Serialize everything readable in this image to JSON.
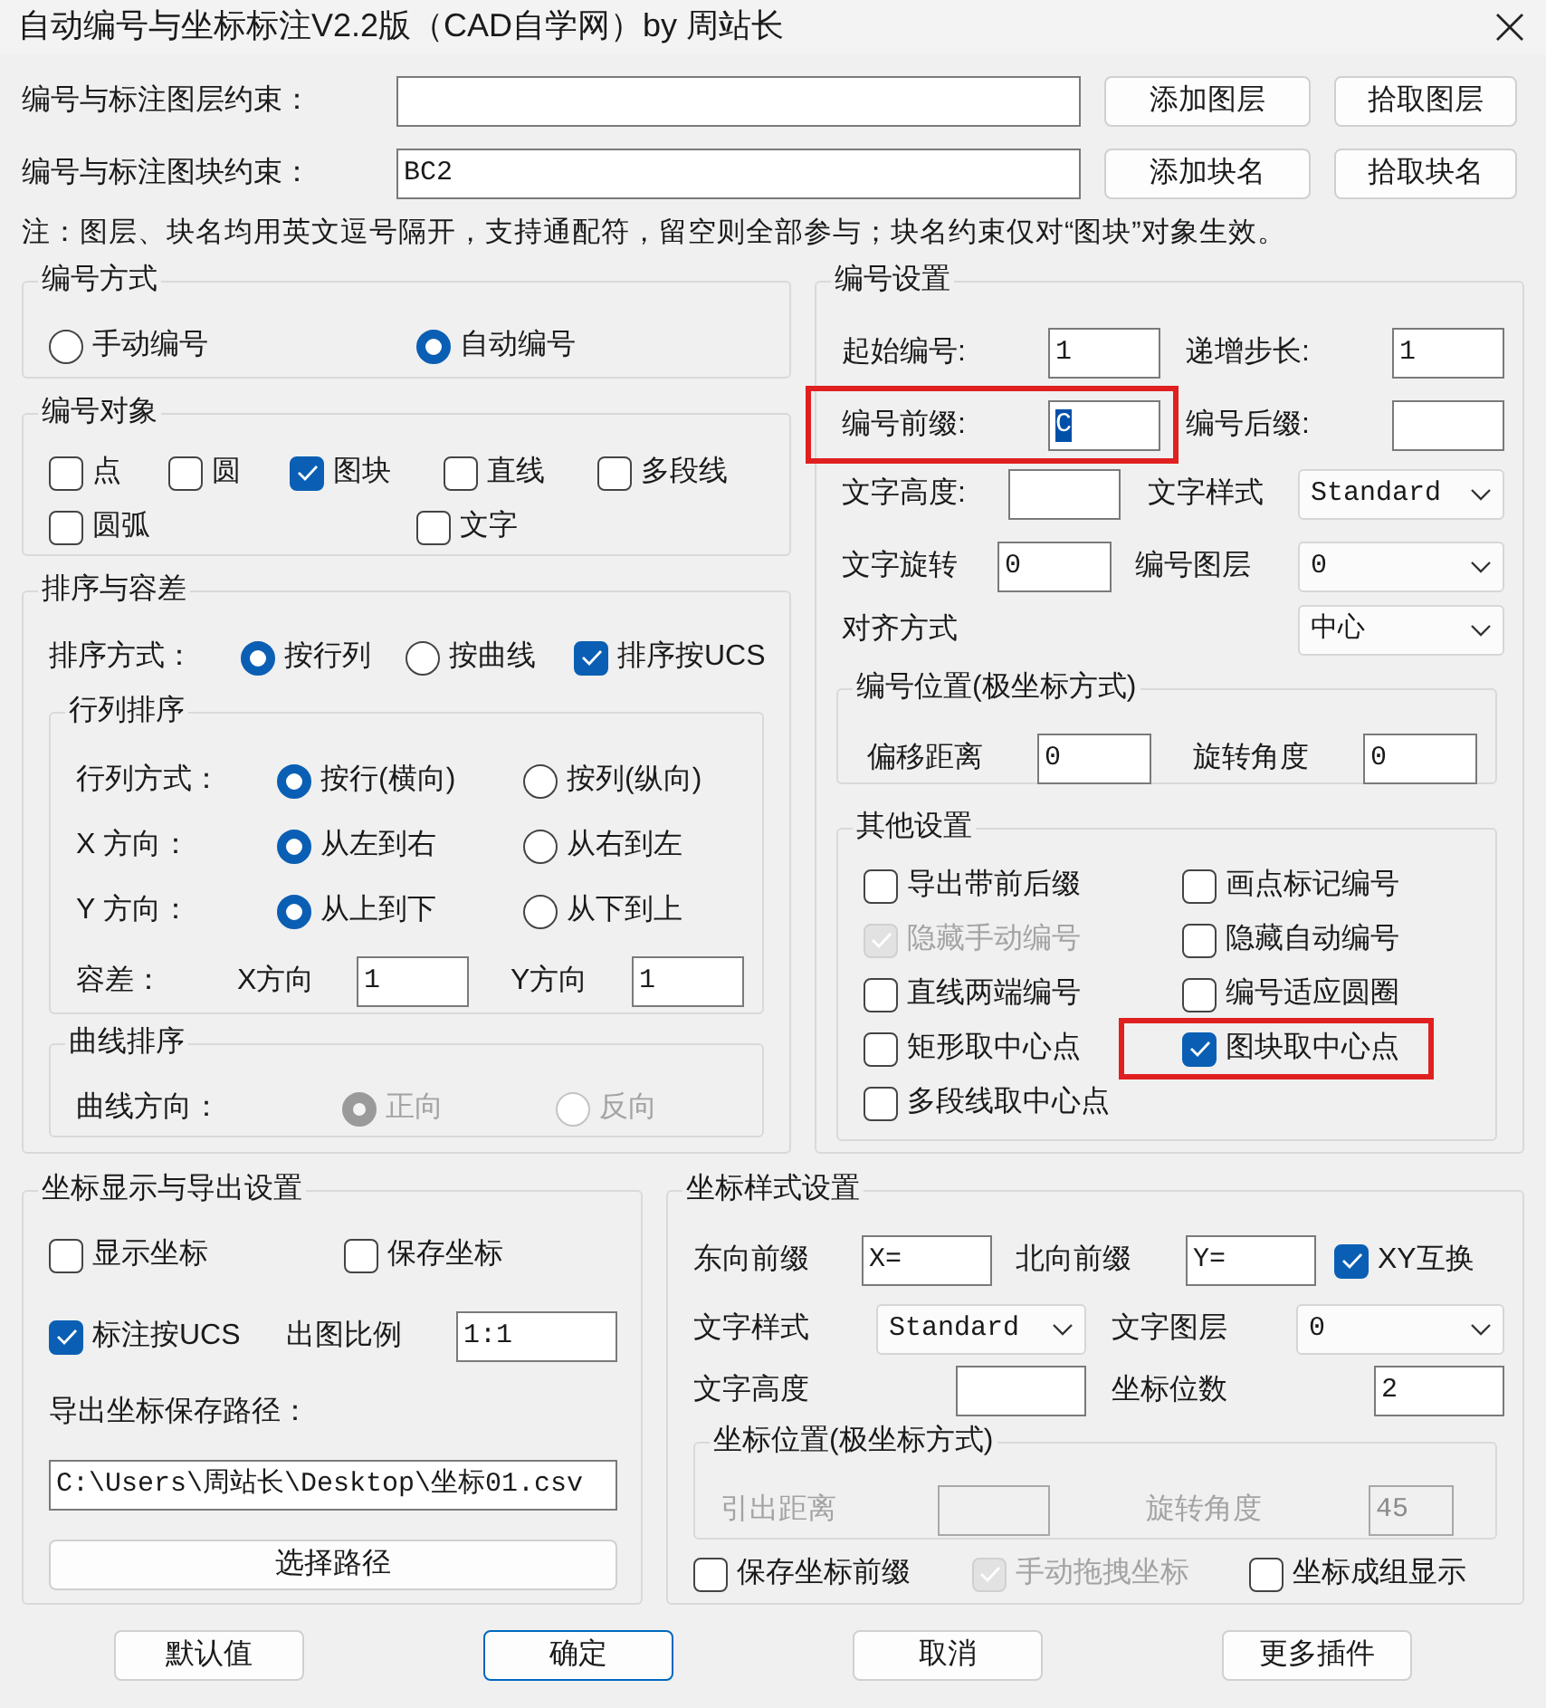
{
  "window": {
    "title": "自动编号与坐标标注V2.2版（CAD自学网）by 周站长"
  },
  "constraints": [
    {
      "label": "编号与标注图层约束：",
      "buttons": [
        "添加图层",
        "拾取图层"
      ]
    },
    {
      "label": "编号与标注图块约束：",
      "value": "BC2",
      "buttons": [
        "添加块名",
        "拾取块名"
      ]
    }
  ],
  "note": "注：图层、块名均用英文逗号隔开，支持通配符，留空则全部参与；块名约束仅对“图块”对象生效。",
  "left_groups": [
    {
      "title": "编号方式",
      "rows": [
        {
          "kind": "row",
          "controls": [
            {
              "kind": "radio",
              "label": "手动编号",
              "checked": false,
              "disabled": false
            },
            {
              "kind": "radio",
              "label": "自动编号",
              "checked": true,
              "disabled": false
            }
          ]
        }
      ]
    },
    {
      "title": "编号对象",
      "rows": [
        {
          "kind": "row",
          "controls": [
            {
              "kind": "checkbox",
              "label": "点",
              "checked": false,
              "disabled": false
            },
            {
              "kind": "checkbox",
              "label": "圆",
              "checked": false,
              "disabled": false
            },
            {
              "kind": "checkbox",
              "label": "图块",
              "checked": true,
              "disabled": false
            },
            {
              "kind": "checkbox",
              "label": "直线",
              "checked": false,
              "disabled": false
            },
            {
              "kind": "checkbox",
              "label": "多段线",
              "checked": false,
              "disabled": false
            }
          ]
        },
        {
          "kind": "row",
          "controls": [
            {
              "kind": "checkbox",
              "label": "圆弧",
              "checked": false,
              "disabled": false
            },
            {
              "kind": "checkbox",
              "label": "文字",
              "checked": false,
              "disabled": false
            }
          ]
        }
      ]
    },
    {
      "title": "排序与容差",
      "rows": [
        {
          "kind": "row",
          "controls": [
            {
              "kind": "label",
              "text": "排序方式："
            },
            {
              "kind": "radio",
              "label": "按行列",
              "checked": true,
              "disabled": false
            },
            {
              "kind": "radio",
              "label": "按曲线",
              "checked": false,
              "disabled": false
            },
            {
              "kind": "checkbox",
              "label": "排序按UCS",
              "checked": true,
              "disabled": false
            }
          ]
        },
        {
          "kind": "group",
          "title": "行列排序",
          "rows": [
            {
              "kind": "row",
              "controls": [
                {
                  "kind": "label",
                  "text": "行列方式："
                },
                {
                  "kind": "radio",
                  "label": "按行(横向)",
                  "checked": true,
                  "disabled": false
                },
                {
                  "kind": "radio",
                  "label": "按列(纵向)",
                  "checked": false,
                  "disabled": false
                }
              ]
            },
            {
              "kind": "row",
              "controls": [
                {
                  "kind": "label",
                  "text": "X 方向："
                },
                {
                  "kind": "radio",
                  "label": "从左到右",
                  "checked": true,
                  "disabled": false
                },
                {
                  "kind": "radio",
                  "label": "从右到左",
                  "checked": false,
                  "disabled": false
                }
              ]
            },
            {
              "kind": "row",
              "controls": [
                {
                  "kind": "label",
                  "text": "Y 方向："
                },
                {
                  "kind": "radio",
                  "label": "从上到下",
                  "checked": true,
                  "disabled": false
                },
                {
                  "kind": "radio",
                  "label": "从下到上",
                  "checked": false,
                  "disabled": false
                }
              ]
            },
            {
              "kind": "row",
              "controls": [
                {
                  "kind": "label",
                  "text": "容差："
                },
                {
                  "kind": "label",
                  "text": "X方向"
                },
                {
                  "kind": "input",
                  "value": "1"
                },
                {
                  "kind": "label",
                  "text": "Y方向"
                },
                {
                  "kind": "input",
                  "value": "1"
                }
              ]
            }
          ]
        },
        {
          "kind": "group",
          "title": "曲线排序",
          "rows": [
            {
              "kind": "row",
              "controls": [
                {
                  "kind": "label",
                  "text": "曲线方向："
                },
                {
                  "kind": "radio",
                  "label": "正向",
                  "checked": true,
                  "disabled": true
                },
                {
                  "kind": "radio",
                  "label": "反向",
                  "checked": false,
                  "disabled": true
                }
              ]
            }
          ]
        }
      ]
    }
  ],
  "right_groups": [
    {
      "title": "编号设置",
      "rows": [
        {
          "kind": "row",
          "controls": [
            {
              "kind": "label",
              "text": "起始编号:"
            },
            {
              "kind": "input",
              "value": "1"
            },
            {
              "kind": "label",
              "text": "递增步长:"
            },
            {
              "kind": "input",
              "value": "1"
            }
          ]
        },
        {
          "kind": "row",
          "controls": [
            {
              "kind": "callout",
              "controls": [
                {
                  "kind": "label",
                  "text": "编号前缀:"
                },
                {
                  "kind": "input",
                  "value": "C",
                  "text_selected": true
                }
              ]
            },
            {
              "kind": "label",
              "text": "编号后缀:"
            },
            {
              "kind": "input"
            }
          ]
        },
        {
          "kind": "row",
          "controls": [
            {
              "kind": "label",
              "text": "文字高度:"
            },
            {
              "kind": "input"
            },
            {
              "kind": "label",
              "text": "文字样式"
            },
            {
              "kind": "combo",
              "value": "Standard"
            }
          ]
        },
        {
          "kind": "row",
          "controls": [
            {
              "kind": "label",
              "text": "文字旋转"
            },
            {
              "kind": "input",
              "value": "0"
            },
            {
              "kind": "label",
              "text": "编号图层"
            },
            {
              "kind": "combo",
              "value": "0"
            }
          ]
        },
        {
          "kind": "row",
          "controls": [
            {
              "kind": "label",
              "text": "对齐方式"
            },
            {
              "kind": "combo",
              "value": "中心"
            }
          ]
        },
        {
          "kind": "group",
          "title": "编号位置(极坐标方式)",
          "rows": [
            {
              "kind": "row",
              "controls": [
                {
                  "kind": "label",
                  "text": "偏移距离"
                },
                {
                  "kind": "input",
                  "value": "0"
                },
                {
                  "kind": "label",
                  "text": "旋转角度"
                },
                {
                  "kind": "input",
                  "value": "0"
                }
              ]
            }
          ]
        },
        {
          "kind": "group",
          "title": "其他设置",
          "rows": [
            {
              "kind": "row",
              "controls": [
                {
                  "kind": "checkbox",
                  "label": "导出带前后缀",
                  "checked": false,
                  "disabled": false
                },
                {
                  "kind": "checkbox",
                  "label": "画点标记编号",
                  "checked": false,
                  "disabled": false
                }
              ]
            },
            {
              "kind": "row",
              "controls": [
                {
                  "kind": "checkbox",
                  "label": "隐藏手动编号",
                  "checked": true,
                  "disabled": true
                },
                {
                  "kind": "checkbox",
                  "label": "隐藏自动编号",
                  "checked": false,
                  "disabled": false
                }
              ]
            },
            {
              "kind": "row",
              "controls": [
                {
                  "kind": "checkbox",
                  "label": "直线两端编号",
                  "checked": false,
                  "disabled": false
                },
                {
                  "kind": "checkbox",
                  "label": "编号适应圆圈",
                  "checked": false,
                  "disabled": false
                }
              ]
            },
            {
              "kind": "row",
              "controls": [
                {
                  "kind": "checkbox",
                  "label": "矩形取中心点",
                  "checked": false,
                  "disabled": false
                },
                {
                  "kind": "callout",
                  "controls": [
                    {
                      "kind": "checkbox",
                      "label": "图块取中心点",
                      "checked": true,
                      "disabled": false
                    }
                  ]
                }
              ]
            },
            {
              "kind": "row",
              "controls": [
                {
                  "kind": "checkbox",
                  "label": "多段线取中心点",
                  "checked": false,
                  "disabled": false
                }
              ]
            }
          ]
        }
      ]
    }
  ],
  "bottom_left_groups": [
    {
      "title": "坐标显示与导出设置",
      "rows": [
        {
          "kind": "row",
          "controls": [
            {
              "kind": "checkbox",
              "label": "显示坐标",
              "checked": false,
              "disabled": false
            },
            {
              "kind": "checkbox",
              "label": "保存坐标",
              "checked": false,
              "disabled": false
            }
          ]
        },
        {
          "kind": "row",
          "controls": [
            {
              "kind": "checkbox",
              "label": "标注按UCS",
              "checked": true,
              "disabled": false
            },
            {
              "kind": "label",
              "text": "出图比例"
            },
            {
              "kind": "input",
              "value": "1:1"
            }
          ]
        },
        {
          "kind": "row",
          "controls": [
            {
              "kind": "label",
              "text": "导出坐标保存路径："
            }
          ]
        },
        {
          "kind": "row",
          "controls": [
            {
              "kind": "input",
              "value": "C:\\Users\\周站长\\Desktop\\坐标01.csv"
            }
          ]
        },
        {
          "kind": "row",
          "controls": [
            {
              "kind": "button",
              "label": "选择路径"
            }
          ]
        }
      ]
    }
  ],
  "bottom_right_groups": [
    {
      "title": "坐标样式设置",
      "rows": [
        {
          "kind": "row",
          "controls": [
            {
              "kind": "label",
              "text": "东向前缀"
            },
            {
              "kind": "input",
              "value": "X="
            },
            {
              "kind": "label",
              "text": "北向前缀"
            },
            {
              "kind": "input",
              "value": "Y="
            },
            {
              "kind": "checkbox",
              "label": "XY互换",
              "checked": true,
              "disabled": false
            }
          ]
        },
        {
          "kind": "row",
          "controls": [
            {
              "kind": "label",
              "text": "文字样式"
            },
            {
              "kind": "combo",
              "value": "Standard"
            },
            {
              "kind": "label",
              "text": "文字图层"
            },
            {
              "kind": "combo",
              "value": "0"
            }
          ]
        },
        {
          "kind": "row",
          "controls": [
            {
              "kind": "label",
              "text": "文字高度"
            },
            {
              "kind": "input"
            },
            {
              "kind": "label",
              "text": "坐标位数"
            },
            {
              "kind": "input",
              "value": "2"
            }
          ]
        },
        {
          "kind": "group",
          "title": "坐标位置(极坐标方式)",
          "rows": [
            {
              "kind": "row",
              "controls": [
                {
                  "kind": "label",
                  "text": "引出距离",
                  "disabled": true
                },
                {
                  "kind": "input",
                  "disabled": true
                },
                {
                  "kind": "label",
                  "text": "旋转角度",
                  "disabled": true
                },
                {
                  "kind": "input",
                  "value": "45",
                  "disabled": true
                }
              ]
            }
          ]
        },
        {
          "kind": "row",
          "controls": [
            {
              "kind": "checkbox",
              "label": "保存坐标前缀",
              "checked": false,
              "disabled": false
            },
            {
              "kind": "checkbox",
              "label": "手动拖拽坐标",
              "checked": true,
              "disabled": true
            },
            {
              "kind": "checkbox",
              "label": "坐标成组显示",
              "checked": false,
              "disabled": false
            }
          ]
        }
      ]
    }
  ],
  "footer_buttons": [
    {
      "label": "默认值",
      "default": false
    },
    {
      "label": "确定",
      "default": true
    },
    {
      "label": "取消",
      "default": false
    },
    {
      "label": "更多插件",
      "default": false
    }
  ]
}
